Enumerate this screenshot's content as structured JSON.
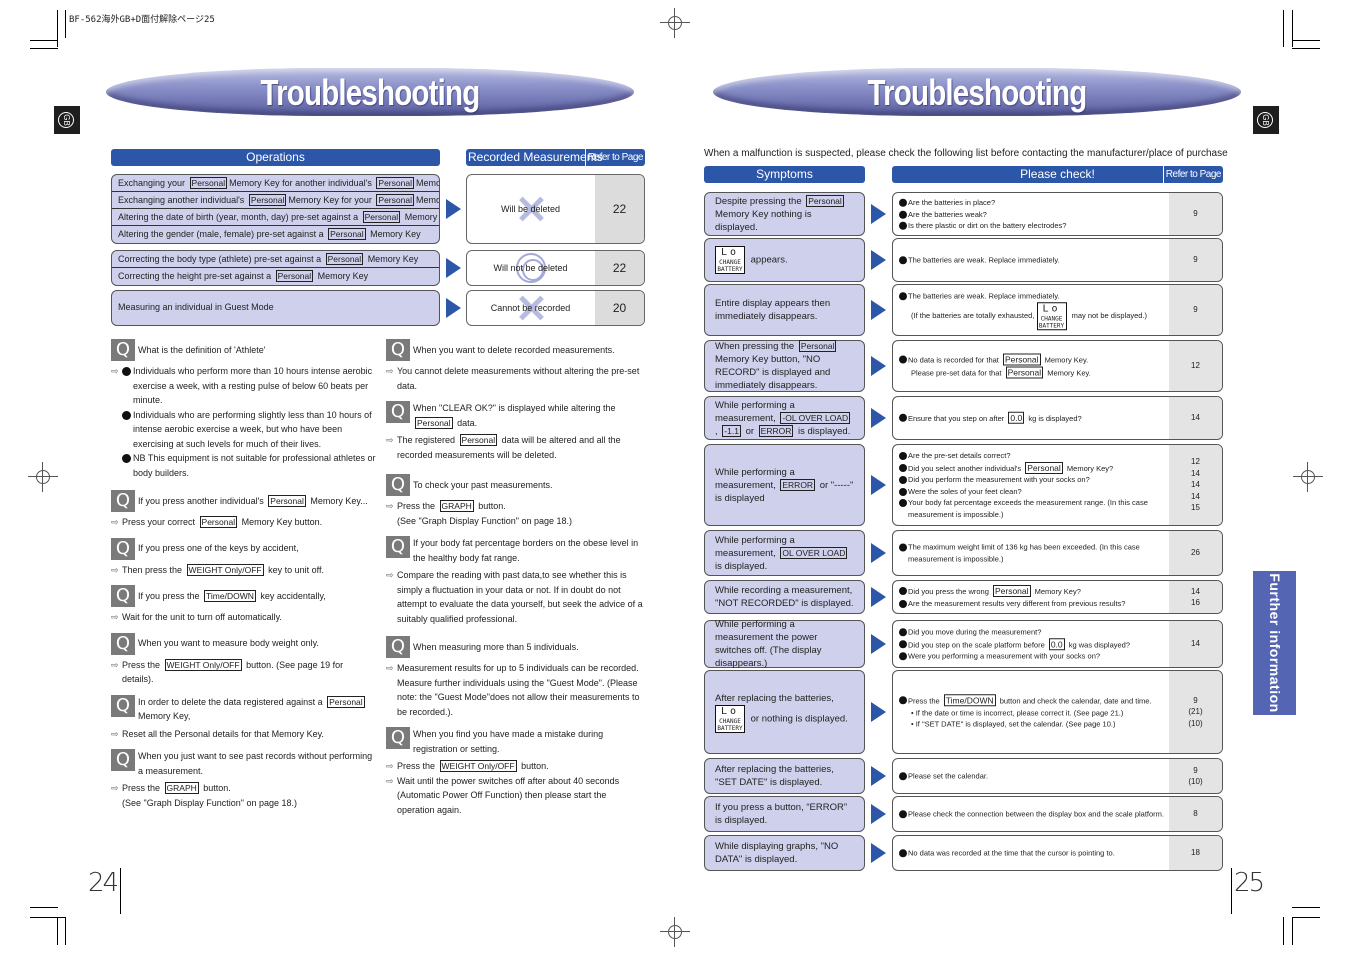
{
  "doc_id": "BF-562海外GB+D面付解除ページ25",
  "left_page": {
    "title": "Troubleshooting",
    "lang_tab": "GB",
    "page_number": "24",
    "operations_header": "Operations",
    "recorded_header": "Recorded Measurements",
    "refer_header": "Refer to Page",
    "groups": [
      {
        "rows": [
          [
            "Exchanging your ",
            "Personal",
            "Memory Key for another individual's ",
            "Personal",
            "Memory Key"
          ],
          [
            "Exchanging another individual's ",
            "Personal",
            "Memory Key for your ",
            "Personal",
            "Memory Key"
          ],
          [
            "Altering the date of birth (year, month, day) pre-set against a ",
            "Personal",
            " Memory Key"
          ],
          [
            "Altering the gender (male, female) pre-set against a ",
            "Personal",
            " Memory Key"
          ]
        ],
        "result": "Will be deleted",
        "result_mark": "x",
        "page": "22"
      },
      {
        "rows": [
          [
            "Correcting the body type (athlete) pre-set against a ",
            "Personal",
            " Memory Key"
          ],
          [
            "Correcting the height pre-set against a ",
            "Personal",
            " Memory Key"
          ]
        ],
        "result": "Will not be deleted",
        "result_mark": "o",
        "page": "22"
      },
      {
        "rows": [
          [
            "Measuring an individual in Guest Mode"
          ]
        ],
        "result": "Cannot be recorded",
        "result_mark": "x",
        "page": "20"
      }
    ],
    "qa_left": [
      {
        "q": "What is the definition of 'Athlete'",
        "a_bullets": [
          "Individuals who perform more than 10 hours intense aerobic exercise a week, with a resting pulse of below 60 beats per minute.",
          "Individuals who are performing slightly less than 10 hours of intense aerobic exercise a week, but who have been exercising at such levels for much of their lives.",
          "NB This equipment is not suitable for professional athletes or body builders."
        ]
      },
      {
        "q": [
          "If you press another individual's ",
          "Personal",
          " Memory Key..."
        ],
        "a": [
          [
            "Press your correct ",
            "Personal",
            " Memory Key button."
          ]
        ]
      },
      {
        "q": "If you press one of the keys by accident,",
        "a": [
          [
            "Then press the ",
            "WEIGHT Only/OFF",
            " key to unit off."
          ]
        ]
      },
      {
        "q": [
          "If you press the ",
          "Time/DOWN",
          " key accidentally,"
        ],
        "a": [
          [
            "Wait for the unit to turn off automatically."
          ]
        ]
      },
      {
        "q": "When you want to measure body weight only.",
        "a": [
          [
            "Press the ",
            "WEIGHT Only/OFF",
            " button. (See page 19 for details)."
          ]
        ]
      },
      {
        "q": [
          "In order to delete the data registered against a ",
          "Personal",
          " Memory Key,"
        ],
        "a": [
          [
            "Reset all the Personal details for that Memory Key."
          ]
        ]
      },
      {
        "q": "When you just want to see past records without performing a measurement.",
        "a": [
          [
            "Press the ",
            "GRAPH",
            " button."
          ],
          [
            "(See \"Graph Display Function\" on page 18.)"
          ]
        ]
      }
    ],
    "qa_right": [
      {
        "q": "When you want to delete recorded measurements.",
        "a": [
          [
            "You cannot delete measurements without altering the pre-set data."
          ]
        ]
      },
      {
        "q": [
          "When \"CLEAR OK?\" is displayed while altering the ",
          "Personal",
          " data."
        ],
        "a": [
          [
            "The registered ",
            "Personal",
            " data will be altered and all the recorded measurements will be deleted."
          ]
        ]
      },
      {
        "q": "To check your past measurements.",
        "a": [
          [
            "Press the ",
            "GRAPH",
            " button."
          ],
          [
            "(See \"Graph Display Function\" on page 18.)"
          ]
        ]
      },
      {
        "q": "If your body fat percentage borders on the obese level in the healthy body fat range.",
        "a": [
          [
            "Compare the reading with past data,to see whether this is simply a fluctuation in your data or not. If in doubt do not attempt to evaluate the data yourself, but seek the advice of a suitably qualified professional."
          ]
        ]
      },
      {
        "q": "When measuring more than 5 individuals.",
        "a": [
          [
            "Measurement results for up to 5 individuals can be recorded. Measure further individuals using the \"Guest Mode\". (Please note: the \"Guest Mode\"does not allow their measurements to be recorded.)."
          ]
        ]
      },
      {
        "q": "When you find you have made a mistake during registration or setting.",
        "a": [
          [
            "Press the ",
            "WEIGHT Only/OFF",
            " button."
          ],
          [
            "Wait until the power switches off after about 40 seconds (Automatic Power Off Function) then please start the operation again."
          ]
        ]
      }
    ]
  },
  "right_page": {
    "title": "Troubleshooting",
    "lang_tab": "GB",
    "page_number": "25",
    "intro": "When a malfunction is suspected, please check the following list before contacting the manufacturer/place of purchase",
    "symptoms_header": "Symptoms",
    "check_header": "Please check!",
    "refer_header": "Refer to Page",
    "side_tab": "Further information",
    "lcd": {
      "lo": "Lo",
      "line1": "CHANGE",
      "line2": "BATTERY"
    },
    "rows": [
      {
        "symptom": [
          "Despite pressing the ",
          "Personal",
          " Memory Key nothing is displayed."
        ],
        "checks": [
          {
            "t": [
              "Are the batteries in place?"
            ]
          },
          {
            "t": [
              "Are the batteries weak?"
            ]
          },
          {
            "t": [
              "Is there plastic or dirt on the battery electrodes?"
            ]
          }
        ],
        "refs": [
          "9"
        ]
      },
      {
        "symptom": [
          "@lcd",
          " appears."
        ],
        "checks": [
          {
            "t": [
              "The batteries are weak. Replace immediately."
            ]
          }
        ],
        "refs": [
          "9"
        ]
      },
      {
        "symptom": [
          "Entire display appears then immediately disappears."
        ],
        "checks": [
          {
            "t": [
              "The batteries are weak. Replace immediately."
            ]
          },
          {
            "sub": true,
            "t": [
              "(If the batteries are totally exhausted, ",
              "@lcd",
              " may not be displayed.)"
            ]
          }
        ],
        "refs": [
          "9"
        ]
      },
      {
        "symptom": [
          "When pressing the ",
          "Personal",
          " Memory Key button, \"NO RECORD\" is displayed and immediately disappears."
        ],
        "checks": [
          {
            "t": [
              "No data is recorded for that ",
              "Personal",
              " Memory Key."
            ]
          },
          {
            "sub": true,
            "t": [
              "Please pre-set data for that ",
              "Personal",
              " Memory Key."
            ]
          }
        ],
        "refs": [
          "12"
        ]
      },
      {
        "symptom": [
          "While performing a measurement, ",
          "-OL OVER LOAD",
          ", ",
          "-1.1",
          " or ",
          "ERROR",
          " is displayed."
        ],
        "checks": [
          {
            "t": [
              "Ensure that you step on after ",
              "0.0",
              " kg is displayed?"
            ]
          }
        ],
        "refs": [
          "14"
        ]
      },
      {
        "symptom": [
          "While performing a measurement, ",
          "ERROR",
          " or \"-----\" is displayed"
        ],
        "checks": [
          {
            "t": [
              "Are the pre-set details correct?"
            ]
          },
          {
            "t": [
              "Did you select another individual's ",
              "Personal",
              " Memory Key?"
            ]
          },
          {
            "t": [
              "Did you perform the measurement with your socks on?"
            ]
          },
          {
            "t": [
              "Were the soles of your feet clean?"
            ]
          },
          {
            "t": [
              "Your body fat percentage exceeds the measurement range. (In this case measurement is impossible.)"
            ]
          }
        ],
        "refs": [
          "12",
          "14",
          "14",
          "14",
          "15"
        ]
      },
      {
        "symptom": [
          "While performing a measurement, ",
          "OL OVER LOAD",
          " is displayed."
        ],
        "checks": [
          {
            "t": [
              "The maximum weight limit of 136 kg has been exceeded. (In this case measurement is impossible.)"
            ]
          }
        ],
        "refs": [
          "26"
        ]
      },
      {
        "symptom": [
          "While recording a measurement, \"NOT RECORDED\" is displayed."
        ],
        "checks": [
          {
            "t": [
              "Did you press the wrong ",
              "Personal",
              " Memory Key?"
            ]
          },
          {
            "t": [
              "Are the measurement results very different from previous results?"
            ]
          }
        ],
        "refs": [
          "14",
          "16"
        ]
      },
      {
        "symptom": [
          "While performing a measurement the power switches off. (The display disappears.)"
        ],
        "checks": [
          {
            "t": [
              "Did you move during the measurement?"
            ]
          },
          {
            "t": [
              "Did you step on the scale platform before ",
              "0.0",
              " kg was displayed?"
            ]
          },
          {
            "t": [
              "Were you performing a measurement with your socks on?"
            ]
          }
        ],
        "refs": [
          "14"
        ]
      },
      {
        "symptom": [
          "After replacing the batteries, ",
          "@lcd",
          " or nothing is displayed."
        ],
        "checks": [
          {
            "t": [
              "Press the ",
              "Time/DOWN",
              " button and check the calendar, date and time."
            ]
          },
          {
            "sub": true,
            "dot": true,
            "t": [
              "If the date or time is incorrect, please correct it. (See page 21.)"
            ]
          },
          {
            "sub": true,
            "dot": true,
            "t": [
              "If \"SET DATE\" is displayed, set the calendar. (See page 10.)"
            ]
          }
        ],
        "refs": [
          "9",
          "(21)",
          "(10)"
        ]
      },
      {
        "symptom": [
          "After replacing the batteries, \"SET DATE\" is displayed."
        ],
        "checks": [
          {
            "t": [
              "Please set the calendar."
            ]
          }
        ],
        "refs": [
          "9",
          "(10)"
        ]
      },
      {
        "symptom": [
          "If you press a button, “ERROR” is displayed."
        ],
        "checks": [
          {
            "t": [
              "Please check the connection between the display box and the scale platform."
            ]
          }
        ],
        "refs": [
          "8"
        ]
      },
      {
        "symptom": [
          "While displaying graphs, \"NO DATA\" is displayed."
        ],
        "checks": [
          {
            "t": [
              "No data was recorded at the time that the cursor is pointing to."
            ]
          }
        ],
        "refs": [
          "18"
        ]
      }
    ]
  }
}
